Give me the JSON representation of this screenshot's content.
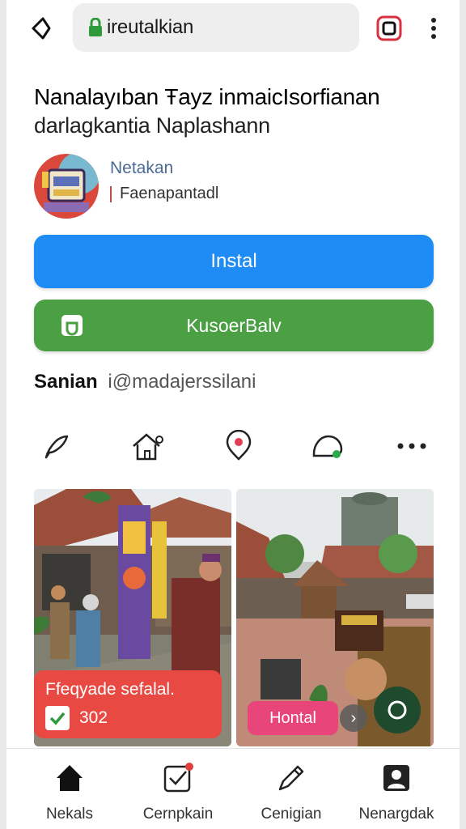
{
  "browser": {
    "url": "ireutalkian"
  },
  "header": {
    "title_line1": "Nanalayıban Ŧayz inmaicIsorfianan",
    "title_line2": "darlagkantia Naplashann"
  },
  "profile": {
    "name": "Netakan",
    "subtitle": "Faenapantadl"
  },
  "buttons": {
    "install_label": "Instal",
    "secondary_label": "KusoerBalv"
  },
  "section": {
    "label": "Sanian",
    "handle": "i@madajerssilani"
  },
  "cards": {
    "promo_title": "Ffeqyade sefalal.",
    "promo_count": "302",
    "tag_label": "Hontal"
  },
  "bottom_nav": {
    "items": [
      {
        "label": "Nekals",
        "icon": "home-icon"
      },
      {
        "label": "Cernpkain",
        "icon": "checkbox-icon"
      },
      {
        "label": "Cenigian",
        "icon": "edit-icon"
      },
      {
        "label": "Nenargdak",
        "icon": "account-icon"
      }
    ]
  },
  "colors": {
    "install_blue": "#1f8cf5",
    "green": "#4aa043",
    "promo_red": "#e84a43",
    "tag_pink": "#e8457a"
  }
}
